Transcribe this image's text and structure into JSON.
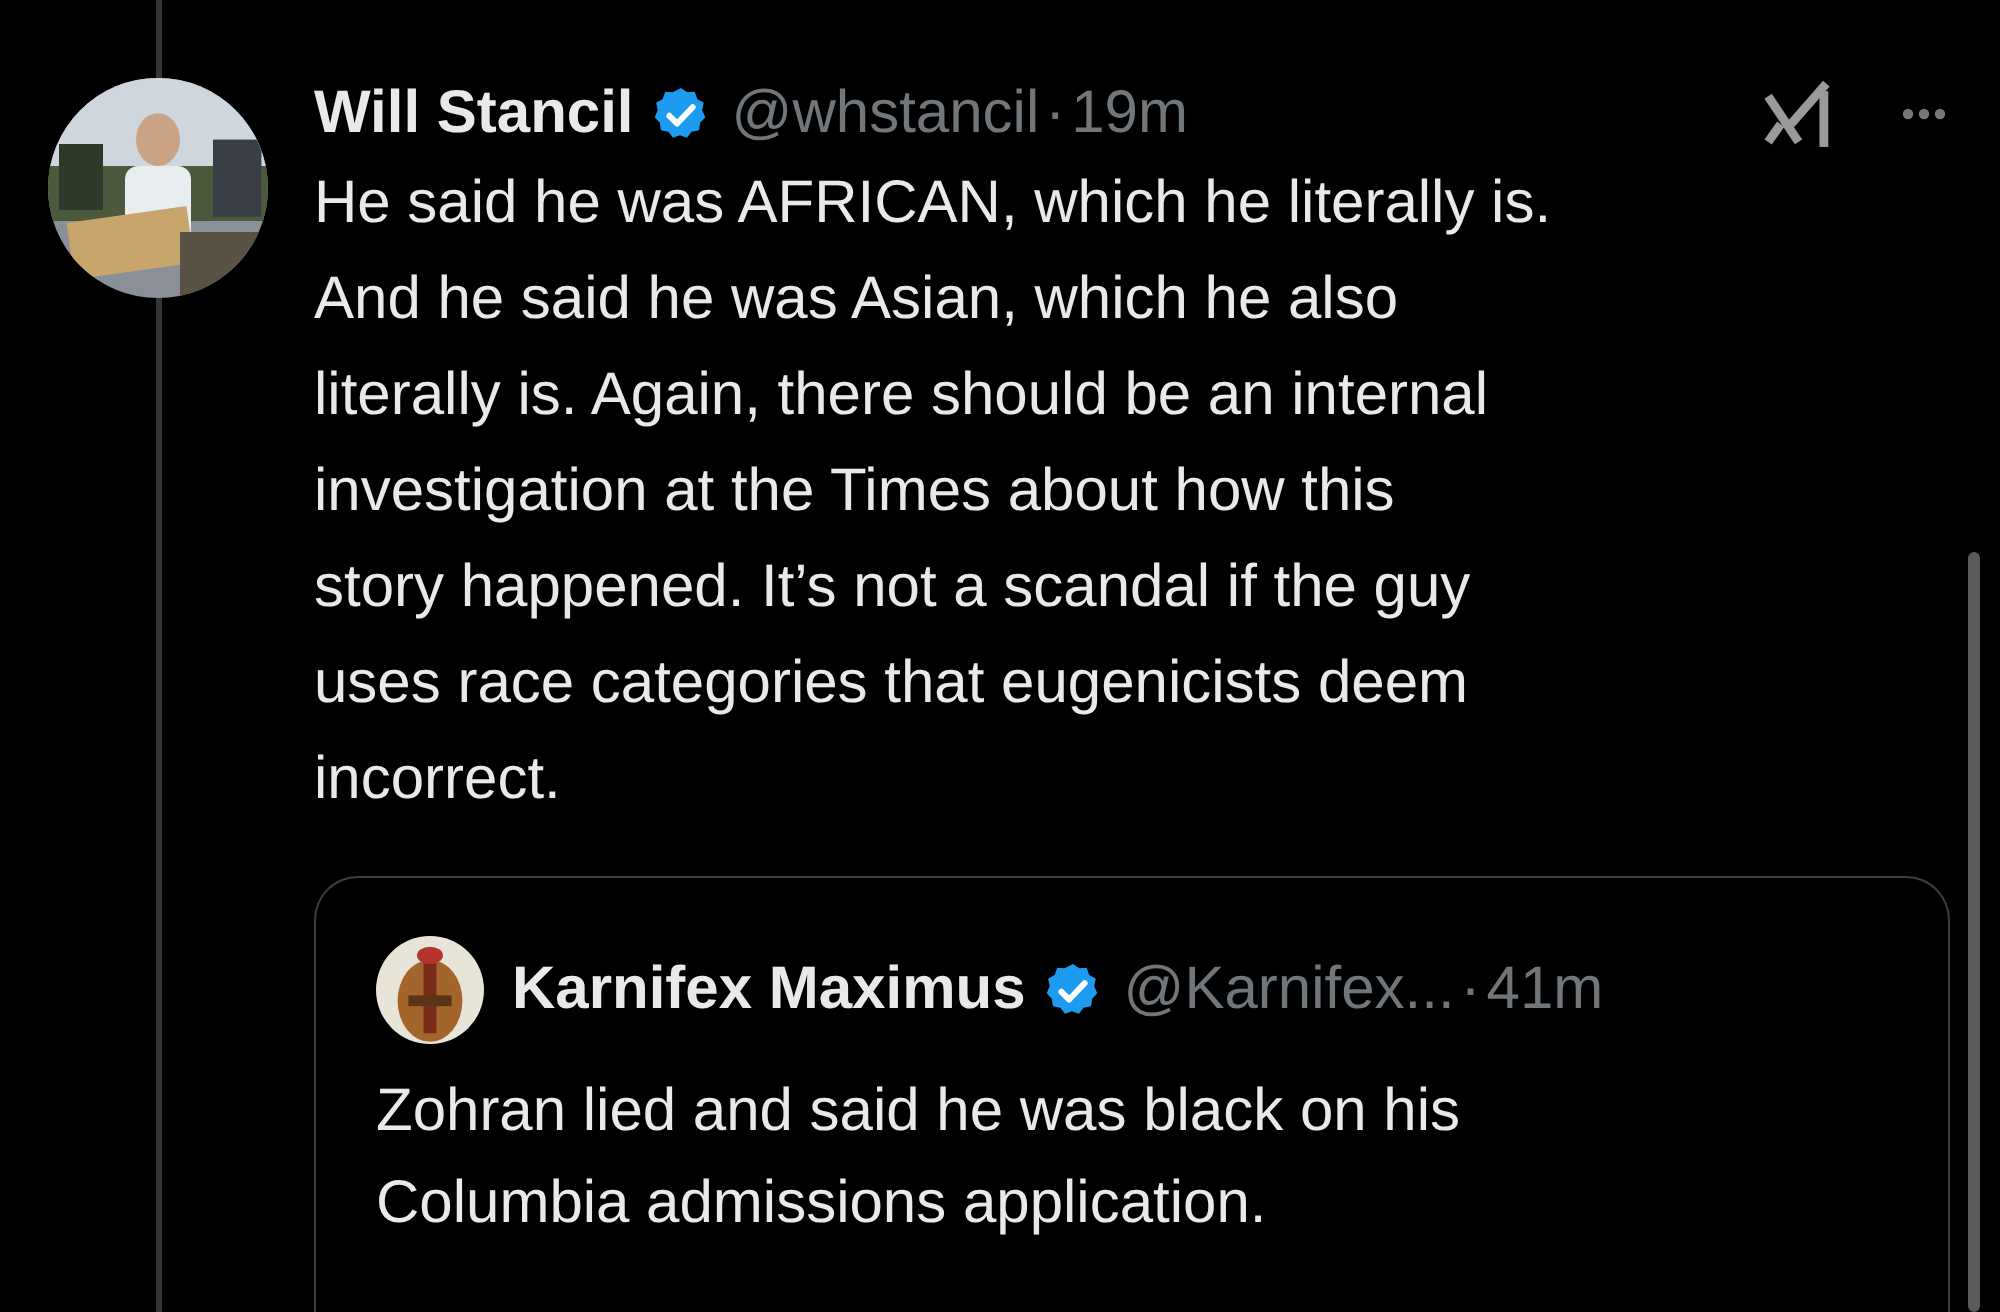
{
  "tweet": {
    "author": {
      "name": "Will Stancil",
      "verified": true,
      "handle": "@whstancil",
      "separator": "·",
      "time": "19m"
    },
    "text": "He said he was AFRICAN, which he literally is.\nAnd he said he was Asian, which he also\nliterally is. Again, there should be an internal\ninvestigation at the Times about how this\nstory happened. It’s not a scandal if the guy\nuses race categories that eugenicists deem\nincorrect.",
    "quote": {
      "author": {
        "name": "Karnifex Maximus",
        "verified": true,
        "handle": "@Karnifex...",
        "separator": "·",
        "time": "41m"
      },
      "text": "Zohran lied and said he was black on his\nColumbia admissions application."
    }
  }
}
